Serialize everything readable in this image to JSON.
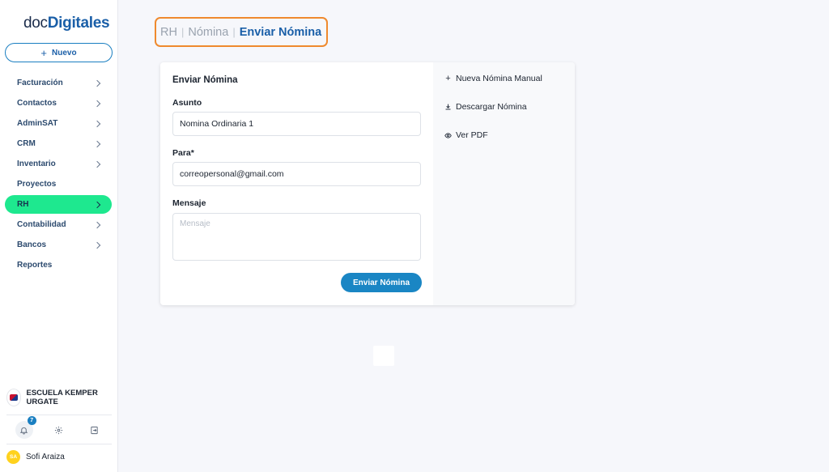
{
  "app": {
    "logo_prefix": "doc",
    "logo_bold": "Digitales"
  },
  "sidebar": {
    "new_button": "Nuevo",
    "items": [
      {
        "label": "Facturación",
        "has_chevron": true
      },
      {
        "label": "Contactos",
        "has_chevron": true
      },
      {
        "label": "AdminSAT",
        "has_chevron": true
      },
      {
        "label": "CRM",
        "has_chevron": true
      },
      {
        "label": "Inventario",
        "has_chevron": true
      },
      {
        "label": "Proyectos",
        "has_chevron": false
      },
      {
        "label": "RH",
        "has_chevron": true,
        "active": true
      },
      {
        "label": "Contabilidad",
        "has_chevron": true
      },
      {
        "label": "Bancos",
        "has_chevron": true
      },
      {
        "label": "Reportes",
        "has_chevron": false
      }
    ],
    "company": "ESCUELA KEMPER URGATE",
    "notifications_count": "7",
    "user": {
      "initials": "SA",
      "name": "Sofi Araiza"
    }
  },
  "breadcrumb": {
    "level1": "RH",
    "level2": "Nómina",
    "current": "Enviar Nómina"
  },
  "form": {
    "title": "Enviar Nómina",
    "subject_label": "Asunto",
    "subject_value": "Nomina Ordinaria 1",
    "to_label": "Para*",
    "to_value": "correopersonal@gmail.com",
    "message_label": "Mensaje",
    "message_placeholder": "Mensaje",
    "submit_label": "Enviar Nómina"
  },
  "side_actions": {
    "new_manual": "Nueva Nómina Manual",
    "download": "Descargar Nómina",
    "view_pdf": "Ver PDF"
  },
  "colors": {
    "accent": "#1a86c4",
    "active_nav": "#1ee88f",
    "highlight_border": "#ef8a2e"
  }
}
